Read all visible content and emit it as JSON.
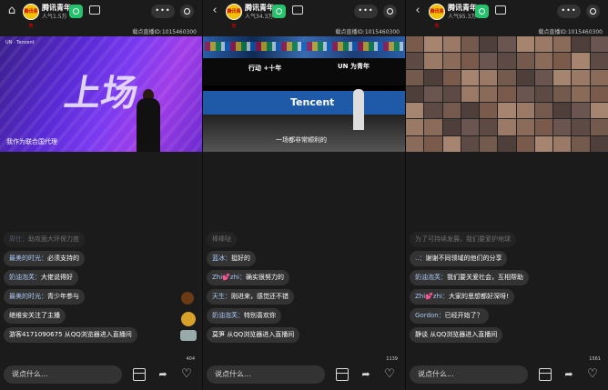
{
  "panels": [
    {
      "nav_icon": "home-icon",
      "nav_glyph": "⌂",
      "channel": {
        "avatar_text": "腾讯青年",
        "name": "腾讯青年",
        "popularity": "人气1.5万"
      },
      "more_label": "•••",
      "room_id": "载点直播ID:1015460300",
      "video": {
        "logo": "UN · Tencent",
        "big_text": "上场",
        "caption": "我作为联合国代理"
      },
      "messages": [
        {
          "user": "周仕：",
          "text": "助攻面大环保力度",
          "faded": true
        },
        {
          "user": "最美的时光：",
          "text": "必须支持的"
        },
        {
          "user": "奶油泡芙：",
          "text": "大佬说得好"
        },
        {
          "user": "最美的时光：",
          "text": "青少年参与"
        },
        {
          "user": "",
          "text": "继维安关注了主播"
        },
        {
          "user": "",
          "text": "游客4171090675 从QQ浏览器进入直播间"
        }
      ],
      "like_count": "404",
      "input_placeholder": "说点什么..."
    },
    {
      "nav_icon": "back-icon",
      "nav_glyph": "‹",
      "channel": {
        "avatar_text": "腾讯青年",
        "name": "腾讯青年",
        "popularity": "人气34.3万"
      },
      "more_label": "•••",
      "room_id": "载点直播ID:1015460300",
      "video": {
        "t1": "行动 +十年",
        "t2": "UN 为青年",
        "screen": "Tencent",
        "caption": "一场都非常顺利的"
      },
      "messages": [
        {
          "user": "",
          "text": "棒棒哒",
          "faded": true
        },
        {
          "user": "蓝冰：",
          "text": "挺好的"
        },
        {
          "user": "Zhi💕zhi：",
          "text": "确实很努力的"
        },
        {
          "user": "天生：",
          "text": "刚进来，感觉还不错"
        },
        {
          "user": "奶油泡芙：",
          "text": "特别喜欢你"
        },
        {
          "user": "",
          "text": "莫笋 从QQ浏览器进入直播间"
        }
      ],
      "like_count": "1139",
      "input_placeholder": "说点什么..."
    },
    {
      "nav_icon": "back-icon",
      "nav_glyph": "‹",
      "channel": {
        "avatar_text": "腾讯青年",
        "name": "腾讯青年",
        "popularity": "人气95.3万"
      },
      "more_label": "•••",
      "room_id": "载点直播ID:1015460300",
      "messages": [
        {
          "user": "",
          "text": "为了可持续发展，我们要爱护地球",
          "faded": true
        },
        {
          "user": "..：",
          "text": "谢谢不同领域的他们的分享"
        },
        {
          "user": "奶油泡芙：",
          "text": "我们要关爱社会，互相帮助"
        },
        {
          "user": "Zhi💕zhi：",
          "text": "大家的思想都好深呀!"
        },
        {
          "user": "Gordon：",
          "text": "已经开始了？"
        },
        {
          "user": "",
          "text": "静谈 从QQ浏览器进入直播间"
        }
      ],
      "like_count": "1561",
      "input_placeholder": "说点什么..."
    }
  ]
}
